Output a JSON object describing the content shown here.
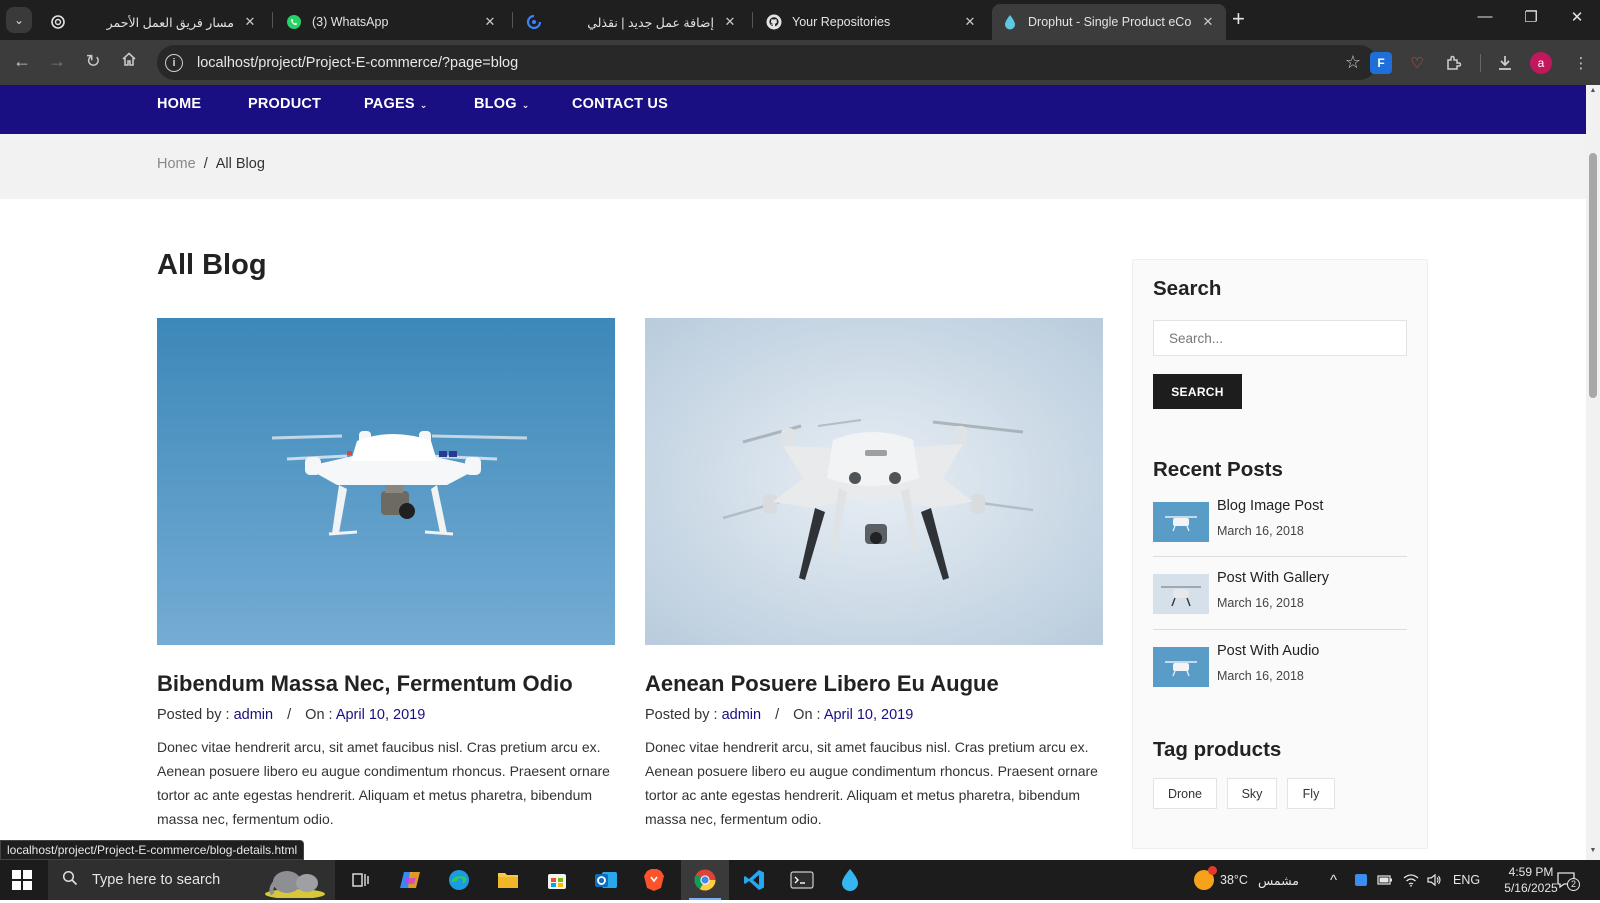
{
  "browser": {
    "tabs": [
      {
        "title": "مسار فريق العمل الأحمر",
        "rtl": true,
        "icon": "openai-icon"
      },
      {
        "title": "(3) WhatsApp",
        "rtl": false,
        "icon": "whatsapp-icon"
      },
      {
        "title": "إضافة عمل جديد | نقذلي",
        "rtl": true,
        "icon": "naqdly-icon"
      },
      {
        "title": "Your Repositories",
        "rtl": false,
        "icon": "github-icon"
      },
      {
        "title": "Drophut - Single Product eCom",
        "rtl": false,
        "icon": "drop-icon",
        "active": true
      }
    ],
    "url": "localhost/project/Project-E-commerce/?page=blog",
    "extension_label": "F",
    "profile_initial": "a",
    "status_url": "localhost/project/Project-E-commerce/blog-details.html"
  },
  "nav": {
    "items": [
      {
        "label": "HOME"
      },
      {
        "label": "PRODUCT"
      },
      {
        "label": "PAGES",
        "caret": true
      },
      {
        "label": "BLOG",
        "caret": true
      },
      {
        "label": "CONTACT US"
      }
    ],
    "caret_glyph": "⌄"
  },
  "breadcrumb": {
    "home": "Home",
    "separator": "/",
    "current": "All Blog"
  },
  "page_title": "All Blog",
  "posts": [
    {
      "title": "Bibendum Massa Nec, Fermentum Odio",
      "posted_by_label": "Posted by :",
      "author": "admin",
      "on_label": "On :",
      "date": "April 10, 2019",
      "excerpt": "Donec vitae hendrerit arcu, sit amet faucibus nisl. Cras pretium arcu ex. Aenean posuere libero eu augue condimentum rhoncus. Praesent ornare tortor ac ante egestas hendrerit. Aliquam et metus pharetra, bibendum massa nec, fermentum odio."
    },
    {
      "title": "Aenean Posuere Libero Eu Augue",
      "posted_by_label": "Posted by :",
      "author": "admin",
      "on_label": "On :",
      "date": "April 10, 2019",
      "excerpt": "Donec vitae hendrerit arcu, sit amet faucibus nisl. Cras pretium arcu ex. Aenean posuere libero eu augue condimentum rhoncus. Praesent ornare tortor ac ante egestas hendrerit. Aliquam et metus pharetra, bibendum massa nec, fermentum odio."
    }
  ],
  "sidebar": {
    "search_heading": "Search",
    "search_placeholder": "Search...",
    "search_button": "SEARCH",
    "recent_heading": "Recent Posts",
    "recent_posts": [
      {
        "title": "Blog Image Post",
        "date": "March 16, 2018"
      },
      {
        "title": "Post With Gallery",
        "date": "March 16, 2018"
      },
      {
        "title": "Post With Audio",
        "date": "March 16, 2018"
      }
    ],
    "tags_heading": "Tag products",
    "tags": [
      "Drone",
      "Sky",
      "Fly"
    ]
  },
  "taskbar": {
    "search_placeholder": "Type here to search",
    "weather": "38°C",
    "weather_desc": "مشمس",
    "language": "ENG",
    "time": "4:59 PM",
    "date": "5/16/2025",
    "notifications": "2"
  },
  "colors": {
    "nav_bg": "#1a0f82",
    "link": "#1a0f82",
    "button_bg": "#1d1d1d"
  }
}
